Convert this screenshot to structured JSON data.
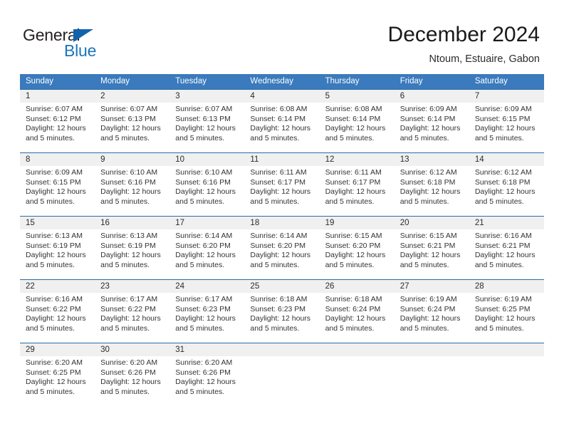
{
  "brand": {
    "word_one": "General",
    "word_two": "Blue",
    "triangle_color": "#1263ad",
    "blue_color": "#1b75bb"
  },
  "header": {
    "title": "December 2024",
    "location": "Ntoum, Estuaire, Gabon"
  },
  "theme": {
    "header_blue": "#3a7abd",
    "row_divider_blue": "#2c6aa8",
    "day_band_gray": "#f0f0f0"
  },
  "weekdays": [
    "Sunday",
    "Monday",
    "Tuesday",
    "Wednesday",
    "Thursday",
    "Friday",
    "Saturday"
  ],
  "weeks": [
    {
      "days": [
        {
          "number": "1",
          "sunrise": "Sunrise: 6:07 AM",
          "sunset": "Sunset: 6:12 PM",
          "daylight": "Daylight: 12 hours and 5 minutes."
        },
        {
          "number": "2",
          "sunrise": "Sunrise: 6:07 AM",
          "sunset": "Sunset: 6:13 PM",
          "daylight": "Daylight: 12 hours and 5 minutes."
        },
        {
          "number": "3",
          "sunrise": "Sunrise: 6:07 AM",
          "sunset": "Sunset: 6:13 PM",
          "daylight": "Daylight: 12 hours and 5 minutes."
        },
        {
          "number": "4",
          "sunrise": "Sunrise: 6:08 AM",
          "sunset": "Sunset: 6:14 PM",
          "daylight": "Daylight: 12 hours and 5 minutes."
        },
        {
          "number": "5",
          "sunrise": "Sunrise: 6:08 AM",
          "sunset": "Sunset: 6:14 PM",
          "daylight": "Daylight: 12 hours and 5 minutes."
        },
        {
          "number": "6",
          "sunrise": "Sunrise: 6:09 AM",
          "sunset": "Sunset: 6:14 PM",
          "daylight": "Daylight: 12 hours and 5 minutes."
        },
        {
          "number": "7",
          "sunrise": "Sunrise: 6:09 AM",
          "sunset": "Sunset: 6:15 PM",
          "daylight": "Daylight: 12 hours and 5 minutes."
        }
      ]
    },
    {
      "days": [
        {
          "number": "8",
          "sunrise": "Sunrise: 6:09 AM",
          "sunset": "Sunset: 6:15 PM",
          "daylight": "Daylight: 12 hours and 5 minutes."
        },
        {
          "number": "9",
          "sunrise": "Sunrise: 6:10 AM",
          "sunset": "Sunset: 6:16 PM",
          "daylight": "Daylight: 12 hours and 5 minutes."
        },
        {
          "number": "10",
          "sunrise": "Sunrise: 6:10 AM",
          "sunset": "Sunset: 6:16 PM",
          "daylight": "Daylight: 12 hours and 5 minutes."
        },
        {
          "number": "11",
          "sunrise": "Sunrise: 6:11 AM",
          "sunset": "Sunset: 6:17 PM",
          "daylight": "Daylight: 12 hours and 5 minutes."
        },
        {
          "number": "12",
          "sunrise": "Sunrise: 6:11 AM",
          "sunset": "Sunset: 6:17 PM",
          "daylight": "Daylight: 12 hours and 5 minutes."
        },
        {
          "number": "13",
          "sunrise": "Sunrise: 6:12 AM",
          "sunset": "Sunset: 6:18 PM",
          "daylight": "Daylight: 12 hours and 5 minutes."
        },
        {
          "number": "14",
          "sunrise": "Sunrise: 6:12 AM",
          "sunset": "Sunset: 6:18 PM",
          "daylight": "Daylight: 12 hours and 5 minutes."
        }
      ]
    },
    {
      "days": [
        {
          "number": "15",
          "sunrise": "Sunrise: 6:13 AM",
          "sunset": "Sunset: 6:19 PM",
          "daylight": "Daylight: 12 hours and 5 minutes."
        },
        {
          "number": "16",
          "sunrise": "Sunrise: 6:13 AM",
          "sunset": "Sunset: 6:19 PM",
          "daylight": "Daylight: 12 hours and 5 minutes."
        },
        {
          "number": "17",
          "sunrise": "Sunrise: 6:14 AM",
          "sunset": "Sunset: 6:20 PM",
          "daylight": "Daylight: 12 hours and 5 minutes."
        },
        {
          "number": "18",
          "sunrise": "Sunrise: 6:14 AM",
          "sunset": "Sunset: 6:20 PM",
          "daylight": "Daylight: 12 hours and 5 minutes."
        },
        {
          "number": "19",
          "sunrise": "Sunrise: 6:15 AM",
          "sunset": "Sunset: 6:20 PM",
          "daylight": "Daylight: 12 hours and 5 minutes."
        },
        {
          "number": "20",
          "sunrise": "Sunrise: 6:15 AM",
          "sunset": "Sunset: 6:21 PM",
          "daylight": "Daylight: 12 hours and 5 minutes."
        },
        {
          "number": "21",
          "sunrise": "Sunrise: 6:16 AM",
          "sunset": "Sunset: 6:21 PM",
          "daylight": "Daylight: 12 hours and 5 minutes."
        }
      ]
    },
    {
      "days": [
        {
          "number": "22",
          "sunrise": "Sunrise: 6:16 AM",
          "sunset": "Sunset: 6:22 PM",
          "daylight": "Daylight: 12 hours and 5 minutes."
        },
        {
          "number": "23",
          "sunrise": "Sunrise: 6:17 AM",
          "sunset": "Sunset: 6:22 PM",
          "daylight": "Daylight: 12 hours and 5 minutes."
        },
        {
          "number": "24",
          "sunrise": "Sunrise: 6:17 AM",
          "sunset": "Sunset: 6:23 PM",
          "daylight": "Daylight: 12 hours and 5 minutes."
        },
        {
          "number": "25",
          "sunrise": "Sunrise: 6:18 AM",
          "sunset": "Sunset: 6:23 PM",
          "daylight": "Daylight: 12 hours and 5 minutes."
        },
        {
          "number": "26",
          "sunrise": "Sunrise: 6:18 AM",
          "sunset": "Sunset: 6:24 PM",
          "daylight": "Daylight: 12 hours and 5 minutes."
        },
        {
          "number": "27",
          "sunrise": "Sunrise: 6:19 AM",
          "sunset": "Sunset: 6:24 PM",
          "daylight": "Daylight: 12 hours and 5 minutes."
        },
        {
          "number": "28",
          "sunrise": "Sunrise: 6:19 AM",
          "sunset": "Sunset: 6:25 PM",
          "daylight": "Daylight: 12 hours and 5 minutes."
        }
      ]
    },
    {
      "days": [
        {
          "number": "29",
          "sunrise": "Sunrise: 6:20 AM",
          "sunset": "Sunset: 6:25 PM",
          "daylight": "Daylight: 12 hours and 5 minutes."
        },
        {
          "number": "30",
          "sunrise": "Sunrise: 6:20 AM",
          "sunset": "Sunset: 6:26 PM",
          "daylight": "Daylight: 12 hours and 5 minutes."
        },
        {
          "number": "31",
          "sunrise": "Sunrise: 6:20 AM",
          "sunset": "Sunset: 6:26 PM",
          "daylight": "Daylight: 12 hours and 5 minutes."
        },
        {
          "number": "",
          "sunrise": "",
          "sunset": "",
          "daylight": ""
        },
        {
          "number": "",
          "sunrise": "",
          "sunset": "",
          "daylight": ""
        },
        {
          "number": "",
          "sunrise": "",
          "sunset": "",
          "daylight": ""
        },
        {
          "number": "",
          "sunrise": "",
          "sunset": "",
          "daylight": ""
        }
      ]
    }
  ]
}
